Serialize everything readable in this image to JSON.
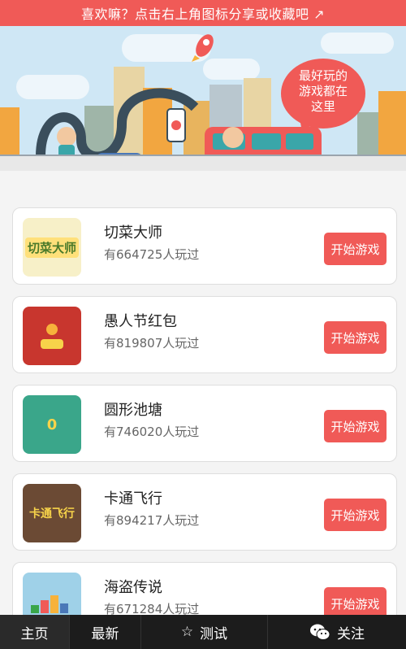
{
  "banner": {
    "text": "喜欢嘛？点击右上角图标分享或收藏吧 ↗"
  },
  "hero": {
    "bubble_lines": [
      "最好玩的",
      "游戏都在",
      "这里"
    ]
  },
  "games": [
    {
      "title": "切菜大师",
      "plays": "有664725人玩过",
      "button": "开始游戏",
      "thumb_text": "切菜大师"
    },
    {
      "title": "愚人节红包",
      "plays": "有819807人玩过",
      "button": "开始游戏",
      "thumb_text": ""
    },
    {
      "title": "圆形池塘",
      "plays": "有746020人玩过",
      "button": "开始游戏",
      "thumb_text": "0"
    },
    {
      "title": "卡通飞行",
      "plays": "有894217人玩过",
      "button": "开始游戏",
      "thumb_text": "卡通飞行"
    },
    {
      "title": "海盗传说",
      "plays": "有671284人玩过",
      "button": "开始游戏",
      "thumb_text": ""
    }
  ],
  "tabs": [
    {
      "label": "主页",
      "icon": ""
    },
    {
      "label": "最新",
      "icon": ""
    },
    {
      "label": "测试",
      "icon": "star-icon"
    },
    {
      "label": "关注",
      "icon": "wechat-icon"
    }
  ]
}
